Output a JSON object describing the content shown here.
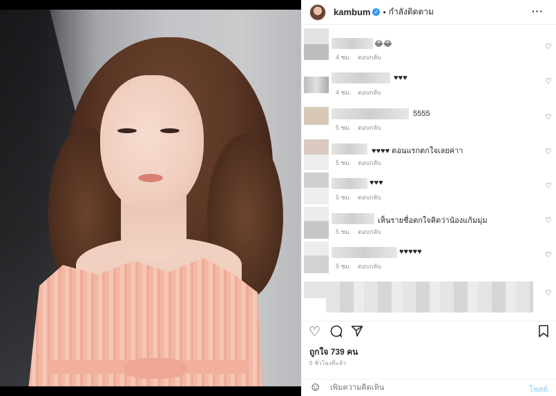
{
  "header": {
    "username": "kambum",
    "verified_mark": "✓",
    "separator": "•",
    "follow_status": "กำลังติดตาม",
    "more_icon": "more-horizontal-icon"
  },
  "comments": [
    {
      "text": "😂😂",
      "time": "4 ชม.",
      "reply": "ตอบกลับ"
    },
    {
      "text": "♥♥♥",
      "time": "4 ชม.",
      "reply": "ตอบกลับ"
    },
    {
      "text": "5555",
      "time": "5 ชม.",
      "reply": "ตอบกลับ"
    },
    {
      "text": "♥♥♥♥ ตอนแรกตกใจเลยค่าา",
      "time": "5 ชม.",
      "reply": "ตอบกลับ"
    },
    {
      "text": "♥♥♥",
      "time": "5 ชม.",
      "reply": "ตอบกลับ"
    },
    {
      "text": "เห็นรายชื่อตกใจคิดว่าน้องแก้มมุ่ม",
      "time": "5 ชม.",
      "reply": "ตอบกลับ"
    },
    {
      "text": "♥♥♥♥♥",
      "time": "5 ชม.",
      "reply": "ตอบกลับ"
    }
  ],
  "actions": {
    "likes": "ถูกใจ 739 คน",
    "time": "5 ชั่วโมงที่แล้ว"
  },
  "composer": {
    "placeholder": "เพิ่มความคิดเห็น",
    "post_label": "โพสต์"
  },
  "colors": {
    "verified": "#3897f0",
    "post_disabled": "#b2dffc"
  }
}
